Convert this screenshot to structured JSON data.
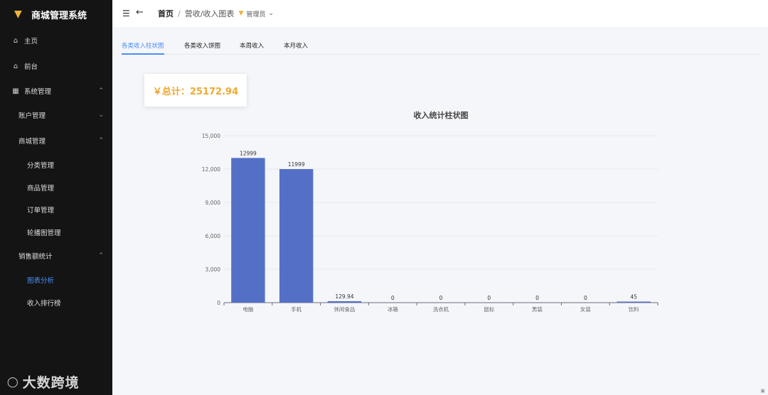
{
  "brand": {
    "title": "商城管理系统"
  },
  "sidebar": {
    "items": [
      {
        "label": "主页",
        "icon": "home-icon"
      },
      {
        "label": "前台",
        "icon": "home-icon"
      },
      {
        "label": "系统管理",
        "icon": "grid-icon"
      },
      {
        "label": "账户管理"
      },
      {
        "label": "商城管理"
      },
      {
        "label": "分类管理"
      },
      {
        "label": "商品管理"
      },
      {
        "label": "订单管理"
      },
      {
        "label": "轮播图管理"
      },
      {
        "label": "销售额统计"
      },
      {
        "label": "图表分析"
      },
      {
        "label": "收入排行榜"
      }
    ]
  },
  "watermark": {
    "text": "大数跨境"
  },
  "header": {
    "breadcrumb_home": "首页",
    "breadcrumb_sep": "/",
    "breadcrumb_current": "营收/收入图表",
    "user": "管理员"
  },
  "tabs": [
    {
      "label": "各类收入柱状图",
      "active": true
    },
    {
      "label": "各类收入饼图",
      "active": false
    },
    {
      "label": "本周收入",
      "active": false
    },
    {
      "label": "本月收入",
      "active": false
    }
  ],
  "total": {
    "text": "￥总计：25172.94"
  },
  "chart_data": {
    "type": "bar",
    "title": "收入统计柱状图",
    "categories": [
      "电脑",
      "手机",
      "休闲食品",
      "冰箱",
      "洗衣机",
      "鼠标",
      "男装",
      "女装",
      "饮料"
    ],
    "values": [
      12999,
      11999,
      129.94,
      0,
      0,
      0,
      0,
      0,
      45
    ],
    "value_labels": [
      "12999",
      "11999",
      "129.94",
      "0",
      "0",
      "0",
      "0",
      "0",
      "45"
    ],
    "yticks": [
      "0",
      "3,000",
      "6,000",
      "9,000",
      "12,000",
      "15,000"
    ],
    "ylim": [
      0,
      15000
    ],
    "bar_color": "#5470c6",
    "grid": true
  },
  "colors": {
    "accent": "#4c8df6",
    "total": "#f0a830",
    "sidebar_bg": "#141414"
  }
}
